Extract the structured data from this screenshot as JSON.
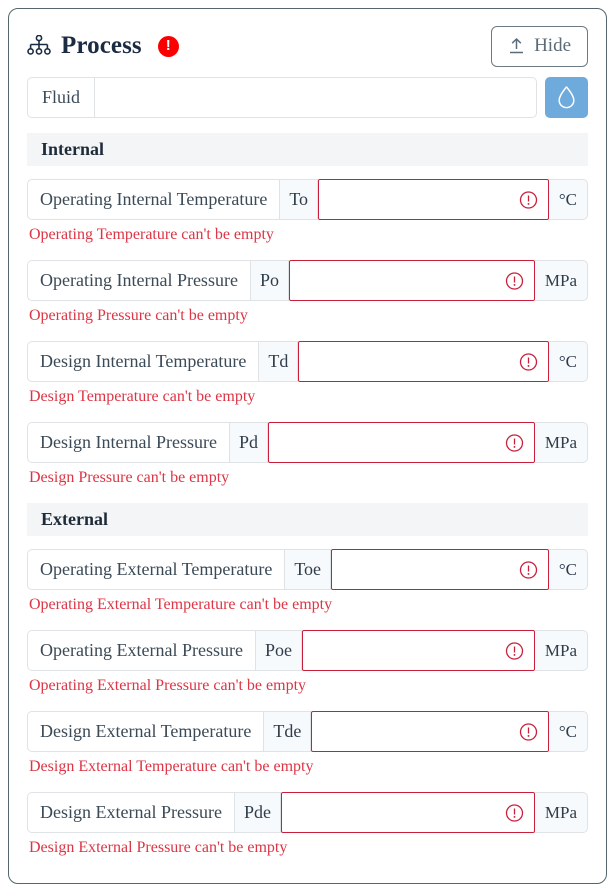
{
  "card": {
    "title": "Process",
    "title_icon": "sitemap-icon",
    "alert_badge": {
      "icon": "exclamation-icon",
      "glyph": "!",
      "color": "#fa0000"
    },
    "hide_button": {
      "label": "Hide",
      "icon": "upload-arrow-icon"
    },
    "border_color": "#56666e"
  },
  "fluid": {
    "label": "Fluid",
    "value": "",
    "placeholder": "",
    "picker_button": {
      "icon": "water-droplet-icon",
      "color": "#6eaadc"
    }
  },
  "sections": [
    {
      "title": "Internal",
      "rows": [
        {
          "label": "Operating Internal Temperature",
          "symbol": "To",
          "value": "",
          "placeholder": "",
          "unit": "°C",
          "invalid": true,
          "error": "Operating Temperature can't be empty",
          "warn_icon": "exclamation-circle-icon"
        },
        {
          "label": "Operating Internal Pressure",
          "symbol": "Po",
          "value": "",
          "placeholder": "",
          "unit": "MPa",
          "invalid": true,
          "error": "Operating Pressure can't be empty",
          "warn_icon": "exclamation-circle-icon"
        },
        {
          "label": "Design Internal Temperature",
          "symbol": "Td",
          "value": "",
          "placeholder": "",
          "unit": "°C",
          "invalid": true,
          "error": "Design Temperature can't be empty",
          "warn_icon": "exclamation-circle-icon"
        },
        {
          "label": "Design Internal Pressure",
          "symbol": "Pd",
          "value": "",
          "placeholder": "",
          "unit": "MPa",
          "invalid": true,
          "error": "Design Pressure can't be empty",
          "warn_icon": "exclamation-circle-icon"
        }
      ]
    },
    {
      "title": "External",
      "rows": [
        {
          "label": "Operating External Temperature",
          "symbol": "Toe",
          "value": "",
          "placeholder": "",
          "unit": "°C",
          "invalid": true,
          "error": "Operating External Temperature can't be empty",
          "warn_icon": "exclamation-circle-icon"
        },
        {
          "label": "Operating External Pressure",
          "symbol": "Poe",
          "value": "",
          "placeholder": "",
          "unit": "MPa",
          "invalid": true,
          "error": "Operating External Pressure can't be empty",
          "warn_icon": "exclamation-circle-icon"
        },
        {
          "label": "Design External Temperature",
          "symbol": "Tde",
          "value": "",
          "placeholder": "",
          "unit": "°C",
          "invalid": true,
          "error": "Design External Temperature can't be empty",
          "warn_icon": "exclamation-circle-icon"
        },
        {
          "label": "Design External Pressure",
          "symbol": "Pde",
          "value": "",
          "placeholder": "",
          "unit": "MPa",
          "invalid": true,
          "error": "Design External Pressure can't be empty",
          "warn_icon": "exclamation-circle-icon"
        }
      ]
    }
  ],
  "theme": {
    "error_color": "#dc3545",
    "invalid_border": "#c8203c",
    "section_bg": "#f4f5f6",
    "accent_blue": "#6eaadc"
  }
}
